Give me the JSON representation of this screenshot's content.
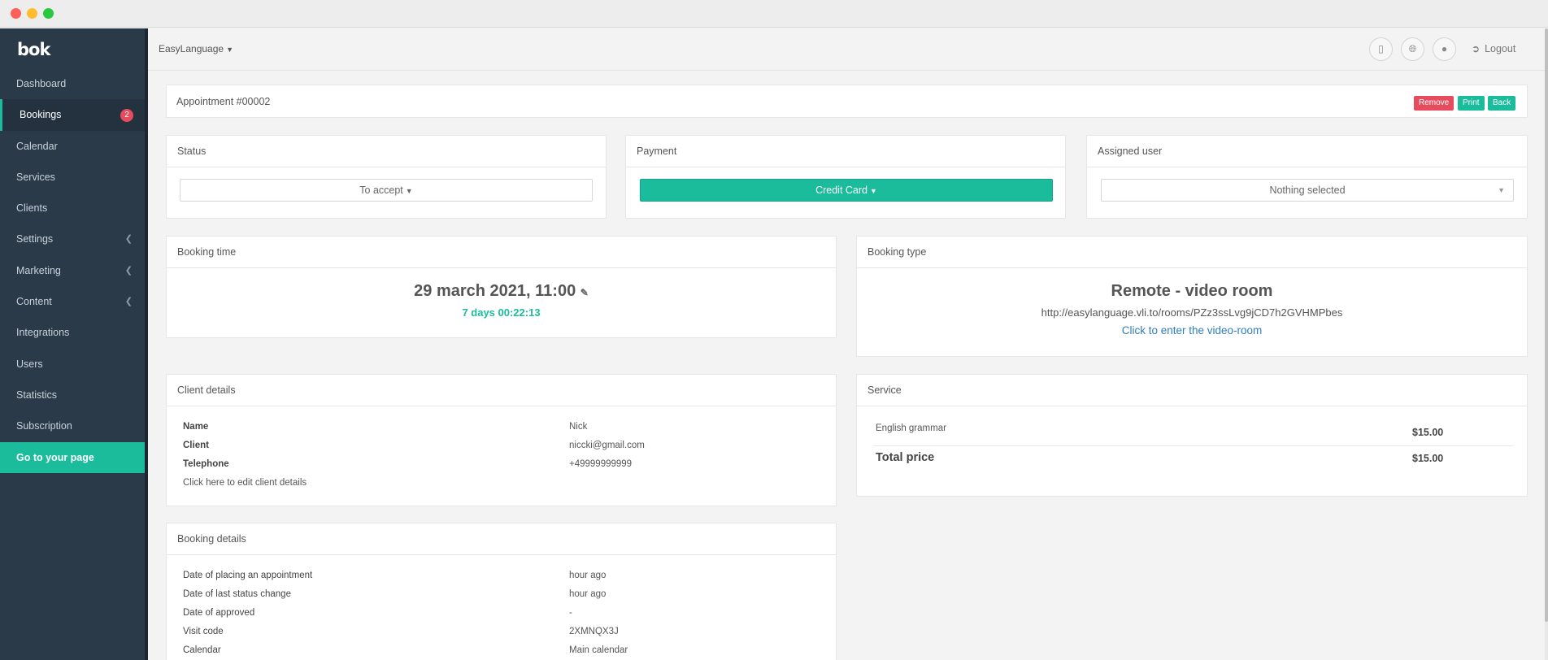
{
  "sidebar": {
    "logo": "bok",
    "items": [
      {
        "label": "Dashboard"
      },
      {
        "label": "Bookings",
        "badge": "2"
      },
      {
        "label": "Calendar"
      },
      {
        "label": "Services"
      },
      {
        "label": "Clients"
      },
      {
        "label": "Settings"
      },
      {
        "label": "Marketing"
      },
      {
        "label": "Content"
      },
      {
        "label": "Integrations"
      },
      {
        "label": "Users"
      },
      {
        "label": "Statistics"
      },
      {
        "label": "Subscription"
      }
    ],
    "cta": "Go to your page"
  },
  "topbar": {
    "brand": "EasyLanguage",
    "logout": "Logout"
  },
  "appointment": {
    "title": "Appointment #00002",
    "remove": "Remove",
    "print": "Print",
    "back": "Back"
  },
  "status": {
    "title": "Status",
    "value": "To accept"
  },
  "payment": {
    "title": "Payment",
    "value": "Credit Card"
  },
  "assigned": {
    "title": "Assigned user",
    "value": "Nothing selected"
  },
  "booking_time": {
    "title": "Booking time",
    "datetime": "29 march 2021, 11:00",
    "countdown": "7 days 00:22:13"
  },
  "booking_type": {
    "title": "Booking type",
    "type": "Remote - video room",
    "url": "http://easylanguage.vli.to/rooms/PZz3ssLvg9jCD7h2GVHMPbes",
    "link": "Click to enter the video-room"
  },
  "client": {
    "title": "Client details",
    "name_label": "Name",
    "name": "Nick",
    "client_label": "Client",
    "email": "niccki@gmail.com",
    "phone_label": "Telephone",
    "phone": "+49999999999",
    "edit_link": "Click here to edit client details"
  },
  "service": {
    "title": "Service",
    "name": "English grammar",
    "price": "$15.00",
    "total_label": "Total price",
    "total": "$15.00"
  },
  "booking_details": {
    "title": "Booking details",
    "rows": [
      {
        "label": "Date of placing an appointment",
        "value": "hour ago"
      },
      {
        "label": "Date of last status change",
        "value": "hour ago"
      },
      {
        "label": "Date of approved",
        "value": "-"
      },
      {
        "label": "Visit code",
        "value": "2XMNQX3J"
      },
      {
        "label": "Calendar",
        "value": "Main calendar"
      }
    ]
  },
  "colors": {
    "accent": "#1abc9c",
    "danger": "#e74c5e",
    "sidebar": "#2b3a48",
    "link": "#2f7fb8"
  }
}
